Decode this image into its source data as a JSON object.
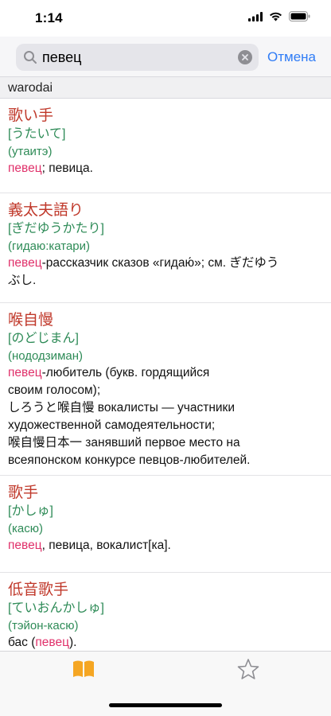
{
  "status": {
    "time": "1:14"
  },
  "search": {
    "value": "певец",
    "cancel_label": "Отмена"
  },
  "section": {
    "title": "warodai"
  },
  "entries": [
    {
      "word": "歌い手",
      "kana": "[うたいて]",
      "reading": "(утаитэ)",
      "meaning_lines": [
        [
          {
            "text": "певец",
            "hl": true
          },
          {
            "text": "; певица.",
            "hl": false
          }
        ]
      ]
    },
    {
      "word": "義太夫語り",
      "kana": "[ぎだゆうかたり]",
      "reading": "(гидаю:катари)",
      "meaning_lines": [
        [
          {
            "text": "певец",
            "hl": true
          },
          {
            "text": "-рассказчик сказов «гидаю́»; см. ぎだゆう",
            "hl": false
          }
        ],
        [
          {
            "text": "ぶし.",
            "hl": false
          }
        ]
      ]
    },
    {
      "word": "喉自慢",
      "kana": "[のどじまん]",
      "reading": "(нододзиман)",
      "meaning_lines": [
        [
          {
            "text": "певец",
            "hl": true
          },
          {
            "text": "-любитель (букв. гордящийся",
            "hl": false
          }
        ],
        [
          {
            "text": "своим голосом);",
            "hl": false
          }
        ],
        [
          {
            "text": "しろうと喉自慢 вокалисты — участники",
            "hl": false
          }
        ],
        [
          {
            "text": "художественной самодеятельности;",
            "hl": false
          }
        ],
        [
          {
            "text": "喉自慢日本一 занявший первое место на",
            "hl": false
          }
        ],
        [
          {
            "text": "всеяпонском конкурсе певцов-любителей.",
            "hl": false
          }
        ]
      ]
    },
    {
      "word": "歌手",
      "kana": "[かしゅ]",
      "reading": "(касю)",
      "meaning_lines": [
        [
          {
            "text": "певец",
            "hl": true
          },
          {
            "text": ", певица, вокалист[ка].",
            "hl": false
          }
        ]
      ]
    },
    {
      "word": "低音歌手",
      "kana": "[ていおんかしゅ]",
      "reading": "(тэйон-касю)",
      "meaning_lines": [
        [
          {
            "text": "бас (",
            "hl": false
          },
          {
            "text": "певец",
            "hl": true
          },
          {
            "text": ").",
            "hl": false
          }
        ]
      ]
    }
  ],
  "tabs": [
    {
      "icon": "book-icon",
      "active": true,
      "color": "#f5a623"
    },
    {
      "icon": "star-icon",
      "active": false,
      "color": "#8e8e93"
    }
  ],
  "colors": {
    "word": "#c0392b",
    "kana": "#2e8b57",
    "highlight": "#e0306a",
    "accent": "#2f7cf6"
  }
}
